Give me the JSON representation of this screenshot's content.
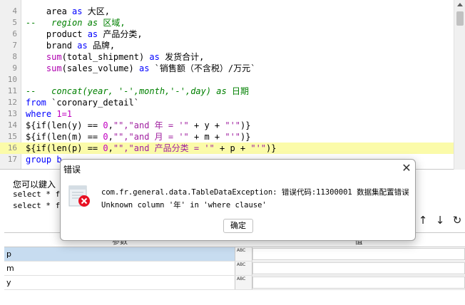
{
  "editor": {
    "lines": [
      {
        "n": "4",
        "tokens": [
          {
            "c": "txt",
            "t": "    area "
          },
          {
            "c": "kw",
            "t": "as"
          },
          {
            "c": "txt",
            "t": " 大区,"
          }
        ]
      },
      {
        "n": "5",
        "tokens": [
          {
            "c": "cm",
            "t": "--   region as "
          },
          {
            "c": "cmz",
            "t": "区域,"
          }
        ]
      },
      {
        "n": "6",
        "tokens": [
          {
            "c": "txt",
            "t": "    product "
          },
          {
            "c": "kw",
            "t": "as"
          },
          {
            "c": "txt",
            "t": " 产品分类,"
          }
        ]
      },
      {
        "n": "7",
        "tokens": [
          {
            "c": "txt",
            "t": "    brand "
          },
          {
            "c": "kw",
            "t": "as"
          },
          {
            "c": "txt",
            "t": " 品牌,"
          }
        ]
      },
      {
        "n": "8",
        "tokens": [
          {
            "c": "txt",
            "t": "    "
          },
          {
            "c": "fn",
            "t": "sum"
          },
          {
            "c": "txt",
            "t": "(total_shipment) "
          },
          {
            "c": "kw",
            "t": "as"
          },
          {
            "c": "txt",
            "t": " 发货合计,"
          }
        ]
      },
      {
        "n": "9",
        "tokens": [
          {
            "c": "txt",
            "t": "    "
          },
          {
            "c": "fn",
            "t": "sum"
          },
          {
            "c": "txt",
            "t": "(sales_volume) "
          },
          {
            "c": "kw",
            "t": "as"
          },
          {
            "c": "txt",
            "t": " `销售额（不含税）/万元`"
          }
        ]
      },
      {
        "n": "10",
        "tokens": []
      },
      {
        "n": "11",
        "tokens": [
          {
            "c": "cm",
            "t": "--   concat(year, '-',month,'-',day) as "
          },
          {
            "c": "cmz",
            "t": "日期"
          }
        ]
      },
      {
        "n": "12",
        "tokens": [
          {
            "c": "kw",
            "t": "from"
          },
          {
            "c": "txt",
            "t": " `coronary_detail`"
          }
        ]
      },
      {
        "n": "13",
        "tokens": [
          {
            "c": "kw",
            "t": "where"
          },
          {
            "c": "txt",
            "t": " "
          },
          {
            "c": "num",
            "t": "1=1"
          }
        ]
      },
      {
        "n": "14",
        "tokens": [
          {
            "c": "txt",
            "t": "${if(len(y) == "
          },
          {
            "c": "num",
            "t": "0"
          },
          {
            "c": "txt",
            "t": ","
          },
          {
            "c": "str",
            "t": "\"\",\"and 年 = '\""
          },
          {
            "c": "txt",
            "t": " + y + "
          },
          {
            "c": "str",
            "t": "\"'\""
          },
          {
            "c": "txt",
            "t": ")}"
          }
        ]
      },
      {
        "n": "15",
        "tokens": [
          {
            "c": "txt",
            "t": "${if(len(m) == "
          },
          {
            "c": "num",
            "t": "0"
          },
          {
            "c": "txt",
            "t": ","
          },
          {
            "c": "str",
            "t": "\"\",\"and 月 = '\""
          },
          {
            "c": "txt",
            "t": " + m + "
          },
          {
            "c": "str",
            "t": "\"'\""
          },
          {
            "c": "txt",
            "t": ")}"
          }
        ]
      },
      {
        "n": "16",
        "tokens": [
          {
            "c": "txt",
            "t": "${if(len(p) == "
          },
          {
            "c": "num",
            "t": "0"
          },
          {
            "c": "txt",
            "t": ","
          },
          {
            "c": "str",
            "t": "\"\",\"and 产品分类 = '\""
          },
          {
            "c": "txt",
            "t": " + p + "
          },
          {
            "c": "str",
            "t": "\"'\""
          },
          {
            "c": "txt",
            "t": ")}"
          }
        ]
      },
      {
        "n": "17",
        "tokens": [
          {
            "c": "kw",
            "t": "group b"
          }
        ]
      }
    ],
    "highlighted_line": "16"
  },
  "bottom": {
    "message": "您可以鍵入",
    "sql_lines": [
      "select * fr",
      "select * fr"
    ],
    "grid_headers": [
      "参数",
      "值"
    ],
    "params": [
      {
        "name": "p",
        "type": "ABC",
        "selected": true
      },
      {
        "name": "m",
        "type": "ABC",
        "selected": false
      },
      {
        "name": "y",
        "type": "ABC",
        "selected": false
      }
    ],
    "tools": {
      "up": "↑",
      "down": "↓",
      "refresh": "↻"
    }
  },
  "dialog": {
    "title": "错误",
    "close": "✕",
    "line1": "com.fr.general.data.TableDataException: 错误代码:11300001 数据集配置错误",
    "line2": "Unknown column '年' in 'where clause'",
    "ok": "确定"
  },
  "colors": {
    "highlight": "#fbfba9",
    "keyword": "#0000ff",
    "function": "#b000b0",
    "comment": "#008000",
    "error": "#e81123",
    "selection": "#c7dcf0"
  }
}
